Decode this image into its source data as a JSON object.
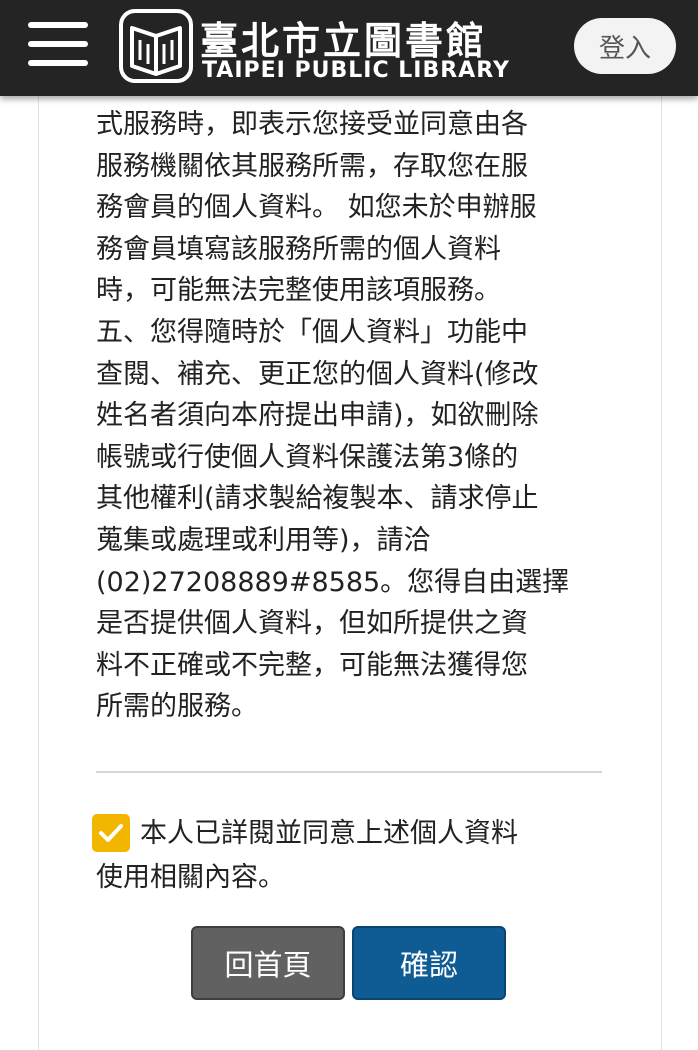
{
  "header": {
    "logo_zh": "臺北市立圖書館",
    "logo_en": "TAIPEI PUBLIC LIBRARY",
    "login_label": "登入"
  },
  "terms": {
    "lines": [
      "式服務時，即表示您接受並同意由各",
      "服務機關依其服務所需，存取您在服",
      "務會員的個人資料。 如您未於申辦服",
      "務會員填寫該服務所需的個人資料",
      "時，可能無法完整使用該項服務。",
      "五、您得隨時於「個人資料」功能中",
      "查閱、補充、更正您的個人資料(修改",
      "姓名者須向本府提出申請)，如欲刪除",
      "帳號或行使個人資料保護法第3條的",
      "其他權利(請求製給複製本、請求停止",
      "蒐集或處理或利用等)，請洽",
      "(02)27208889#8585。您得自由選擇",
      "是否提供個人資料，但如所提供之資",
      "料不正確或不完整，可能無法獲得您",
      "所需的服務。"
    ]
  },
  "agreement": {
    "checked": true,
    "line1": "本人已詳閱並同意上述個人資料",
    "line2": "使用相關內容。"
  },
  "buttons": {
    "home_label": "回首頁",
    "confirm_label": "確認"
  },
  "colors": {
    "header_bg": "#242424",
    "checkbox": "#f2b500",
    "confirm": "#0f5b94",
    "home": "#616161"
  }
}
